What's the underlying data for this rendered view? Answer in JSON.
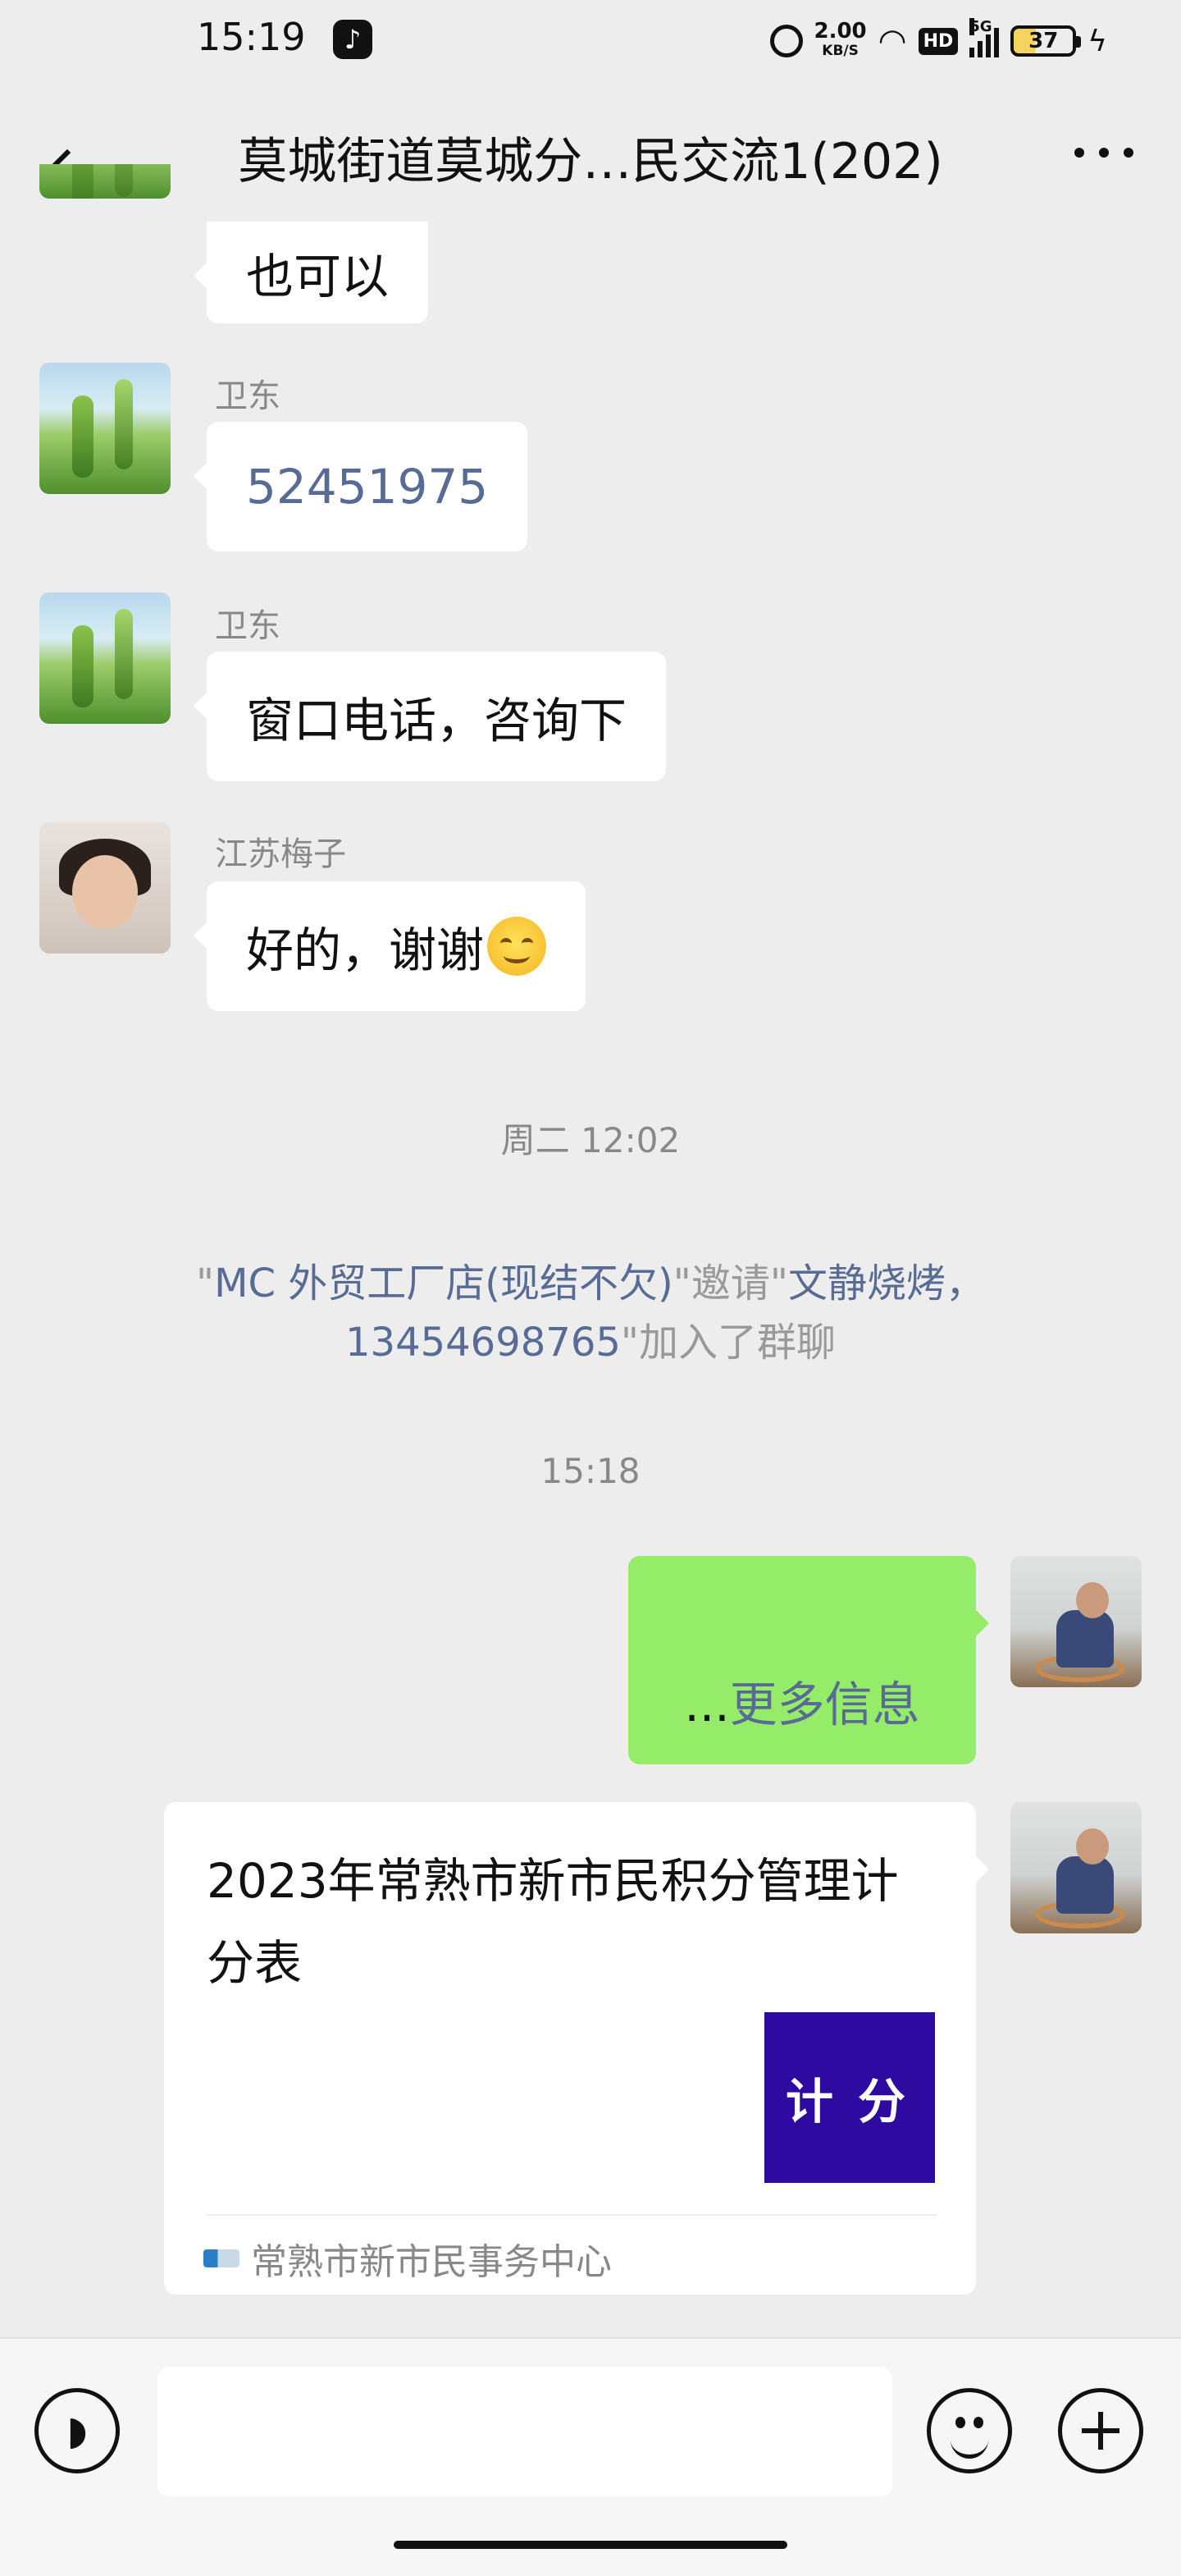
{
  "status_bar": {
    "time": "15:19",
    "net_speed": "2.00",
    "net_unit": "KB/S",
    "hd": "HD",
    "network": "5G",
    "battery": "37"
  },
  "header": {
    "title": "莫城街道莫城分…民交流1(202)"
  },
  "messages": {
    "m0": {
      "text": "也可以"
    },
    "m1": {
      "sender": "卫东",
      "text": "52451975"
    },
    "m2": {
      "sender": "卫东",
      "text": "窗口电话，咨询下"
    },
    "m3": {
      "sender": "江苏梅子",
      "text": "好的，谢谢"
    }
  },
  "timestamps": {
    "t1": "周二 12:02",
    "t2": "15:18"
  },
  "system_message": {
    "quote1": "\"",
    "inviter": "MC  外贸工厂店(现结不欠)",
    "middle": "\"邀请\"",
    "invitee_line1": "文静烧烤，",
    "invitee_line2": "13454698765",
    "end": "\"加入了群聊"
  },
  "outgoing": {
    "text": "...更多信息"
  },
  "card": {
    "title": "2023年常熟市新市民积分管理计分表",
    "thumb_text": "计分",
    "source": "常熟市新市民事务中心"
  }
}
